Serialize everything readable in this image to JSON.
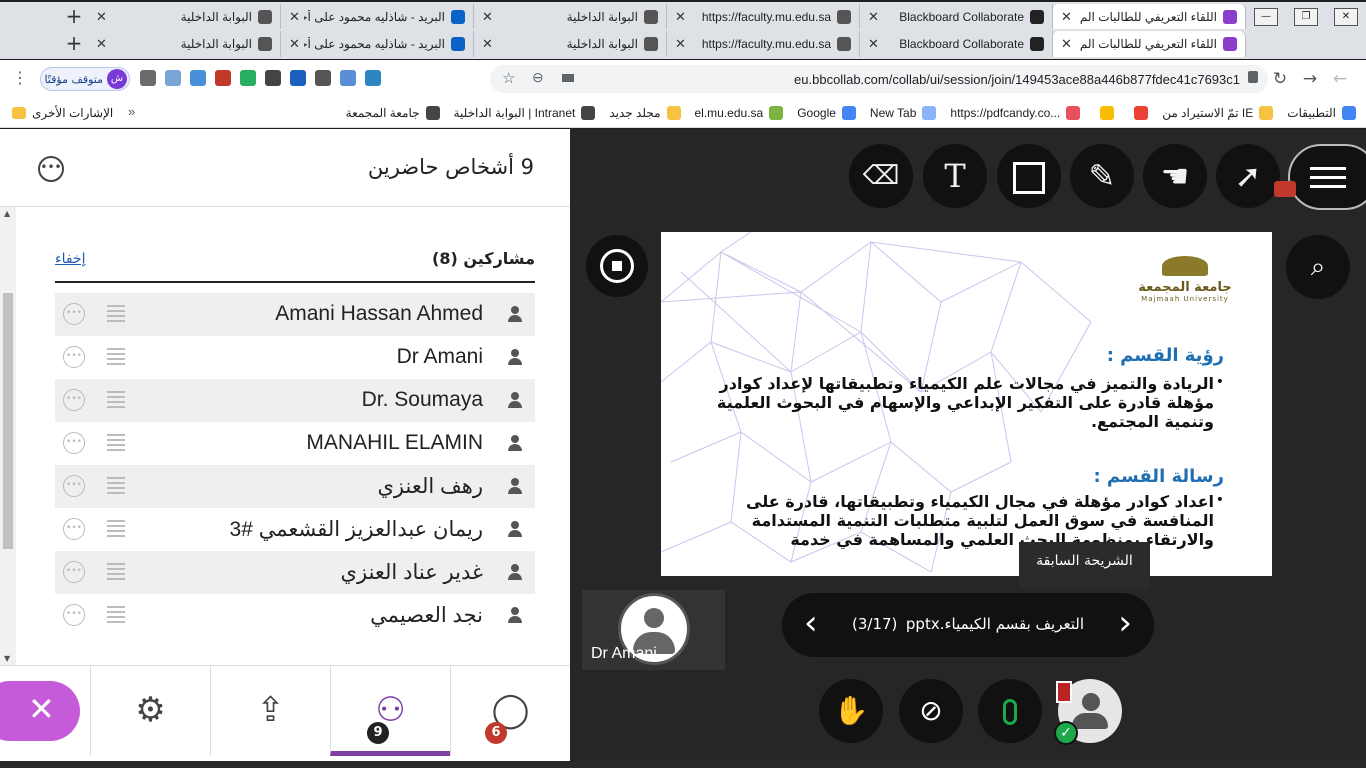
{
  "tabs": [
    {
      "title": "اللقاء التعريفي للطالبات الم",
      "active": true,
      "favicon_color": "#8a3ec9"
    },
    {
      "title": "Blackboard Collaborate",
      "active": false,
      "favicon_color": "#222222"
    },
    {
      "title": "https://faculty.mu.edu.sa",
      "active": false,
      "favicon_color": "#555555"
    },
    {
      "title": "البوابة الداخلية",
      "active": false,
      "favicon_color": "#555555"
    },
    {
      "title": "البريد - شاذليه محمود على أحمد",
      "active": false,
      "favicon_color": "#0a64c8"
    },
    {
      "title": "البوابة الداخلية",
      "active": false,
      "favicon_color": "#555555"
    }
  ],
  "new_tab_label": "+",
  "window_controls": {
    "minimize": "—",
    "maximize": "❐",
    "close": "✕"
  },
  "address_bar": {
    "url": "eu.bbcollab.com/collab/ui/session/join/149453ace88a446b877fdec41c7693c1",
    "profile_status": "متوقف مؤقتًا",
    "profile_initial": "ش"
  },
  "bookmarks": {
    "items": [
      "التطبيقات",
      "تمّ الاستيراد من IE",
      "",
      "",
      "https://pdfcandy.co...",
      "New Tab",
      "Google",
      "el.mu.edu.sa",
      "مجلد جديد",
      "البوابة الداخلية | Intranet",
      "جامعة المجمعة"
    ],
    "other": "الإشارات الأخرى"
  },
  "panel": {
    "title": "9 أشخاص حاضرين",
    "section_title": "مشاركين (8)",
    "hide_link": "إخفاء",
    "participants": [
      "Amani Hassan Ahmed",
      "Dr Amani",
      "Dr. Soumaya",
      "MANAHIL ELAMIN",
      "رهف العنزي",
      "ريمان عبدالعزيز القشعمي #3",
      "غدير عناد العنزي",
      "نجد العصيمي"
    ]
  },
  "bottom_nav": {
    "participants_badge": "9",
    "chat_badge": "6",
    "participants_badge_color": "#222222",
    "chat_badge_color": "#c0392b"
  },
  "slide": {
    "heading_vision": "رؤية القسم :",
    "vision_text": "الريادة والتميز في مجالات علم الكيمياء وتطبيقاتها لإعداد كوادر مؤهلة قادرة على التفكير الإبداعي والإسهام في البحوث العلمية وتنمية المجتمع.",
    "heading_mission": "رسالة القسم :",
    "mission_text": "اعداد كوادر مؤهلة في مجال الكيمياء وتطبيقاتها، قادرة على المنافسة في سوق العمل لتلبية متطلبات التنمية المستدامة والارتقاء بمنظومة البحث العلمي والمساهمة في خدمة",
    "logo_ar": "جامعة المجمعة",
    "logo_en": "Majmaah University",
    "tooltip": "الشريحة السابقة"
  },
  "video": {
    "name": "Dr Amani"
  },
  "pager": {
    "file_name": "التعريف بقسم الكيمياء.pptx",
    "count": "(3/17)"
  },
  "accent_colors": {
    "purple": "#7e3fa3",
    "close_pink": "#c55bd8",
    "mic_green": "#1ba94c"
  }
}
